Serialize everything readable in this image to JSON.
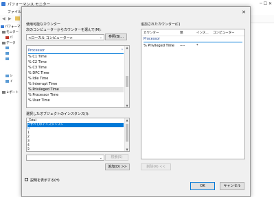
{
  "app": {
    "title": "パフォーマンス モニター",
    "window_controls": "─ ☐ ✕"
  },
  "menu": {
    "file": "ファイル(F)"
  },
  "tree": {
    "items": [
      {
        "label": "パフォーマン"
      },
      {
        "label": "モニター"
      },
      {
        "label": "パ"
      },
      {
        "label": "データ"
      },
      {
        "label": "シ"
      },
      {
        "label": "イ"
      },
      {
        "label": "レポート"
      }
    ]
  },
  "dialog": {
    "close": "✕",
    "available_label": "使用可能なカウンター",
    "select_from_label": "次のコンピューターからカウンターを選んで(M):",
    "computer_value": "<ローカル コンピューター>",
    "browse_button": "参照(B)...",
    "counters": [
      {
        "label": "Processor",
        "header": true
      },
      {
        "label": "% C1 Time"
      },
      {
        "label": "% C2 Time"
      },
      {
        "label": "% C3 Time"
      },
      {
        "label": "% DPC Time"
      },
      {
        "label": "% Idle Time"
      },
      {
        "label": "% Interrupt Time"
      },
      {
        "label": "% Privileged Time",
        "selected": true
      },
      {
        "label": "% Processor Time"
      },
      {
        "label": "% User Time"
      }
    ],
    "instances_label": "選択したオブジェクトのインスタンス(I):",
    "instances": [
      {
        "label": "_Total"
      },
      {
        "label": "<すべてのインスタンス>",
        "highlighted": true
      },
      {
        "label": "0",
        "blue": true
      },
      {
        "label": "1"
      },
      {
        "label": "2"
      },
      {
        "label": "3"
      },
      {
        "label": "4"
      },
      {
        "label": "5"
      }
    ],
    "search_button": "検索(S)",
    "add_button": "追加(D) >>",
    "show_desc_label": "説明を表示する(H)",
    "added_label": "追加されたカウンター(C)",
    "added_headers": {
      "counter": "カウンター",
      "parent": "親",
      "instance": "インス...",
      "computer": "コンピューター"
    },
    "added_group": "Processor",
    "added_rows": [
      {
        "counter": "% Privileged Time",
        "parent": "----",
        "instance": "*"
      }
    ],
    "remove_button": "削除(R) <<",
    "ok_button": "OK",
    "cancel_button": "キャンセル"
  },
  "colors": {
    "selection": "#0078d7",
    "link_blue": "#0066cc"
  }
}
